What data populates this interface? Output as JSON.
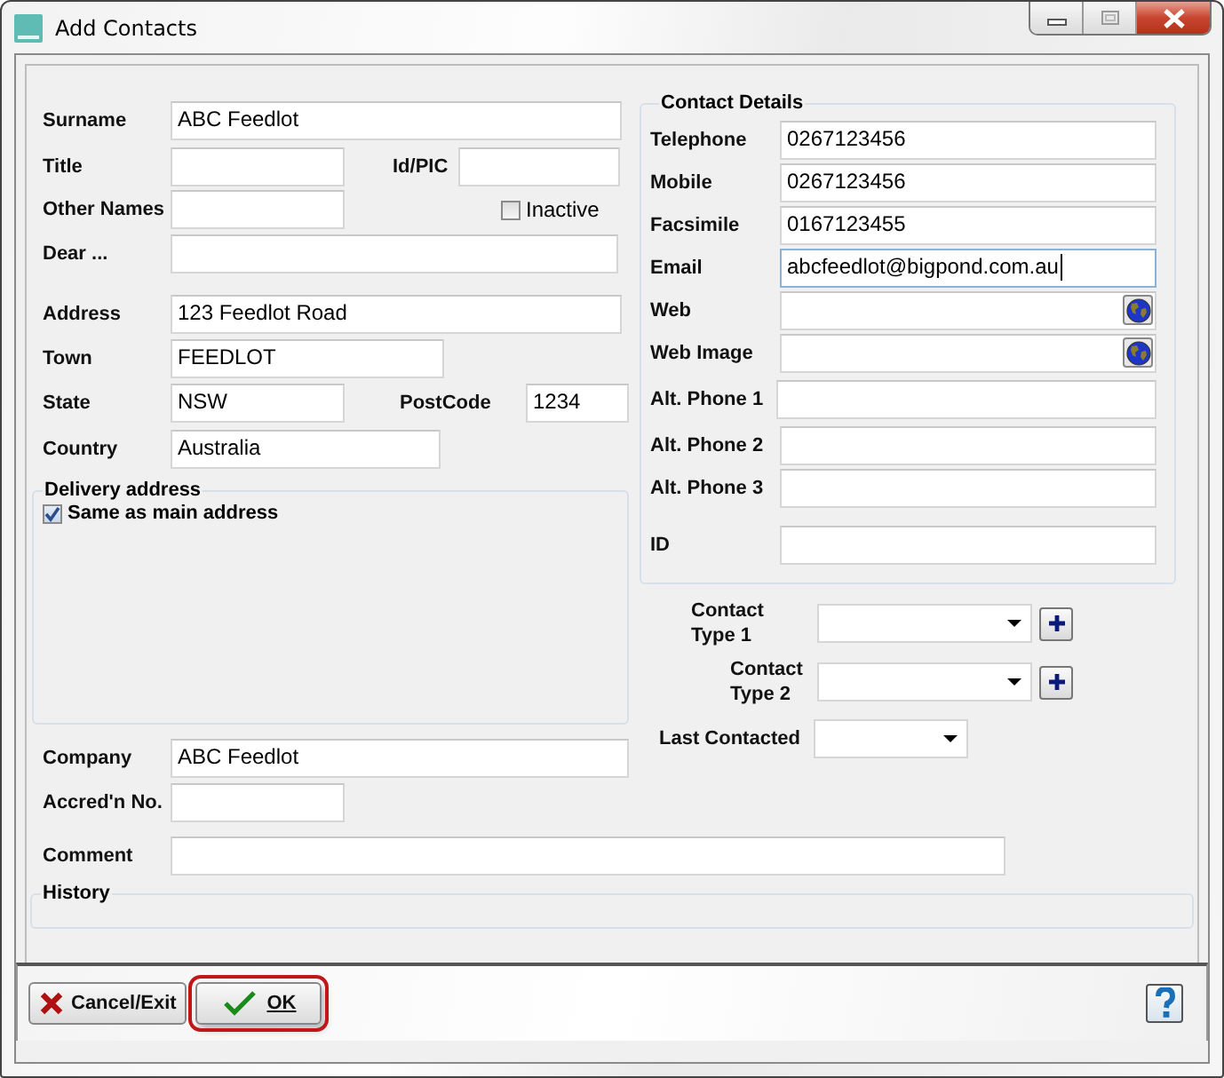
{
  "window": {
    "title": "Add Contacts"
  },
  "left_fields": [
    {
      "label": "Surname",
      "value": "ABC Feedlot"
    },
    {
      "label": "Title"
    },
    {
      "label": "Id/PIC"
    },
    {
      "label": "Other Names"
    },
    {
      "label": "Dear ..."
    },
    {
      "label": "Address",
      "value": "123 Feedlot Road"
    },
    {
      "label": "Town",
      "value": "FEEDLOT"
    },
    {
      "label": "State",
      "value": "NSW"
    },
    {
      "label": "PostCode",
      "value": "1234"
    },
    {
      "label": "Country",
      "value": "Australia"
    }
  ],
  "inactive": {
    "label": "Inactive",
    "checked": false
  },
  "delivery": {
    "title": "Delivery address",
    "same_as_main": {
      "label": "Same as main address",
      "checked": true
    }
  },
  "company_fields": [
    {
      "label": "Company",
      "value": "ABC Feedlot"
    },
    {
      "label": "Accred'n No."
    }
  ],
  "contact_details": {
    "title": "Contact Details",
    "fields": [
      {
        "kind": "text",
        "label": "Telephone",
        "value": "0267123456",
        "focused": false
      },
      {
        "kind": "text",
        "label": "Mobile",
        "value": "0267123456",
        "focused": false
      },
      {
        "kind": "text",
        "label": "Facsimile",
        "value": "0167123455",
        "focused": false
      },
      {
        "kind": "text",
        "label": "Email",
        "value": "abcfeedlot@bigpond.com.au",
        "focused": true
      },
      {
        "kind": "link",
        "label": "Web",
        "focused": false
      },
      {
        "kind": "link",
        "label": "Web Image",
        "focused": false
      },
      {
        "kind": "text",
        "label": "Alt. Phone 1",
        "focused": false
      },
      {
        "kind": "text",
        "label": "Alt. Phone 2",
        "focused": false
      },
      {
        "kind": "text",
        "label": "Alt. Phone 3",
        "focused": false
      },
      {
        "kind": "text",
        "label": "ID",
        "focused": false
      }
    ]
  },
  "contact_types": [
    {
      "label": "Contact Type 1"
    },
    {
      "label": "Contact Type 2"
    }
  ],
  "last_contacted": {
    "label": "Last Contacted"
  },
  "comment": {
    "label": "Comment"
  },
  "history": {
    "title": "History"
  },
  "buttons": [
    {
      "kind": "cancel",
      "label": "Cancel/Exit",
      "highlighted": false
    },
    {
      "kind": "ok",
      "label": "OK",
      "highlighted": true
    }
  ]
}
